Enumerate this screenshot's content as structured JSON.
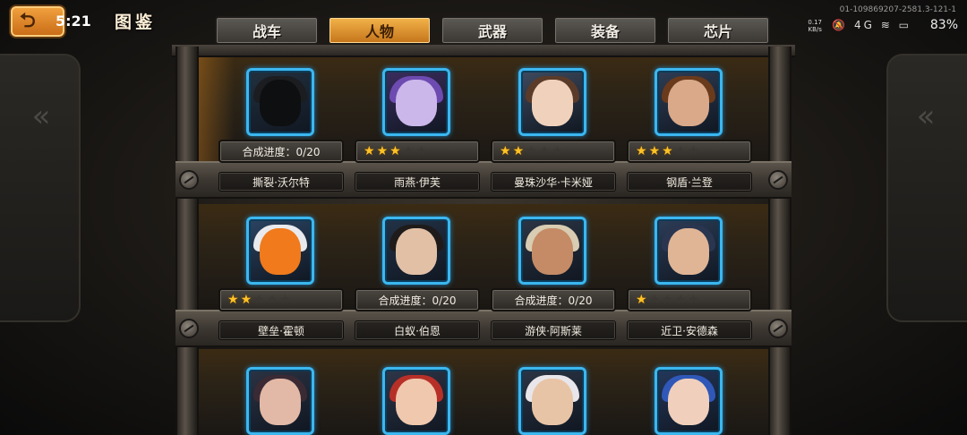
{
  "status_bar": {
    "net_code": "01-109869207-2581.3-121-1",
    "speed_value": "0.17",
    "speed_unit": "KB/s",
    "signal": "4G",
    "battery": "83%"
  },
  "header": {
    "clock": "5:21",
    "title": "图鉴"
  },
  "tabs": [
    {
      "label": "战车",
      "active": false
    },
    {
      "label": "人物",
      "active": true
    },
    {
      "label": "武器",
      "active": false
    },
    {
      "label": "装备",
      "active": false
    },
    {
      "label": "芯片",
      "active": false
    }
  ],
  "rows": [
    [
      {
        "name": "撕裂·沃尔特",
        "progress": "合成进度：0/20",
        "stars": null,
        "portrait": "hooded-figure"
      },
      {
        "name": "雨燕·伊芙",
        "progress": null,
        "stars": 3,
        "portrait": "purple-hair-girl"
      },
      {
        "name": "曼珠沙华·卡米娅",
        "progress": null,
        "stars": 2,
        "portrait": "brown-hair-girl"
      },
      {
        "name": "钢盾·兰登",
        "progress": null,
        "stars": 3,
        "portrait": "bearded-soldier"
      }
    ],
    [
      {
        "name": "壁垒·霍顿",
        "progress": null,
        "stars": 2,
        "portrait": "white-mech"
      },
      {
        "name": "白蚁·伯恩",
        "progress": "合成进度：0/20",
        "stars": null,
        "portrait": "slick-hair-man"
      },
      {
        "name": "游侠·阿斯莱",
        "progress": "合成进度：0/20",
        "stars": null,
        "portrait": "cowboy-hat-man"
      },
      {
        "name": "近卫·安德森",
        "progress": null,
        "stars": 1,
        "portrait": "capped-soldier"
      }
    ],
    [
      {
        "portrait": "dark-hair-eyepatch"
      },
      {
        "portrait": "red-hair-goggles"
      },
      {
        "portrait": "white-hair-fighter"
      },
      {
        "portrait": "blue-hair-girl"
      }
    ]
  ],
  "max_stars": 5,
  "colors": {
    "accent": "#f0a030",
    "frame_blue": "#3bb7f0",
    "star_on": "#ffc225"
  }
}
